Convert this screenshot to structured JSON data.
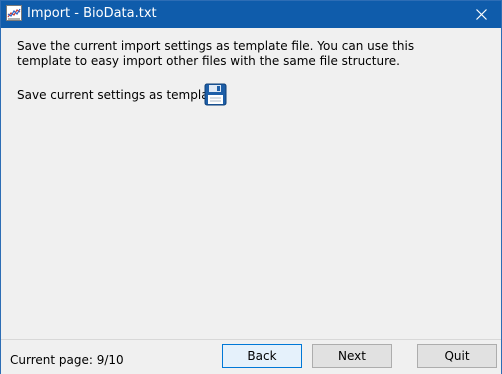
{
  "window": {
    "title": "Import - BioData.txt"
  },
  "content": {
    "description": "Save the current import settings as template file. You can use this template to easy import other files with the same file structure.",
    "save_label": "Save current settings as template:"
  },
  "footer": {
    "page_status": "Current page: 9/10",
    "back_label": "Back",
    "next_label": "Next",
    "quit_label": "Quit"
  },
  "icons": {
    "app": "chart-app-icon",
    "save": "floppy-disk-icon",
    "close": "close-icon"
  },
  "colors": {
    "titlebar": "#0f5cab",
    "window_bg": "#f0f0f0",
    "focused_border": "#0078d7"
  }
}
